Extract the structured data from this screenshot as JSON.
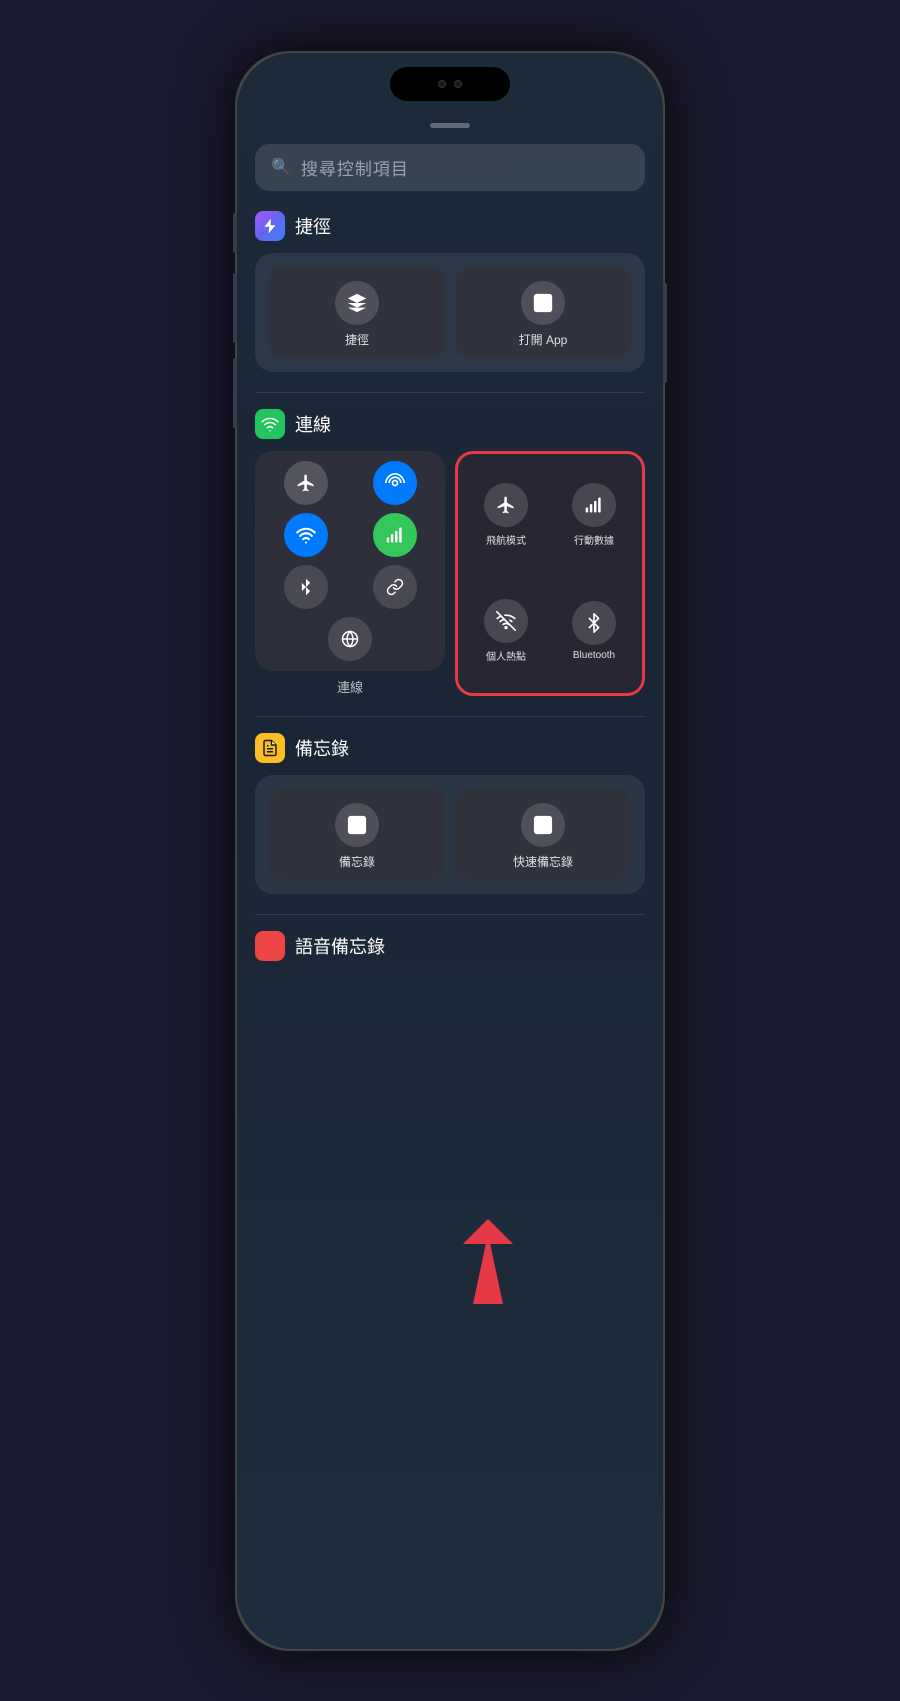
{
  "phone": {
    "search": {
      "placeholder": "搜尋控制項目",
      "icon": "🔍"
    },
    "sections": {
      "shortcuts": {
        "title": "捷徑",
        "items": [
          {
            "label": "捷徑",
            "icon": "shortcuts"
          },
          {
            "label": "打開 App",
            "icon": "open-app"
          }
        ]
      },
      "connectivity": {
        "title": "連線",
        "left_panel_label": "連線",
        "left_items": [
          {
            "icon": "airplane",
            "style": "gray"
          },
          {
            "icon": "hotspot",
            "style": "blue"
          },
          {
            "icon": "wifi",
            "style": "blue"
          },
          {
            "icon": "cellular",
            "style": "green"
          },
          {
            "icon": "bluetooth",
            "style": "dark"
          },
          {
            "icon": "link",
            "style": "dark"
          },
          {
            "icon": "globe",
            "style": "dark"
          }
        ],
        "right_items": [
          {
            "label": "飛航模式",
            "icon": "airplane"
          },
          {
            "label": "行動數據",
            "icon": "cellular"
          },
          {
            "label": "個人熱點",
            "icon": "hotspot-off"
          },
          {
            "label": "Bluetooth",
            "icon": "bluetooth"
          }
        ]
      },
      "notes": {
        "title": "備忘錄",
        "items": [
          {
            "label": "備忘錄",
            "icon": "notes"
          },
          {
            "label": "快速備忘錄",
            "icon": "quick-note"
          }
        ]
      },
      "voice_memos": {
        "title": "語音備忘錄",
        "icon": "waveform"
      }
    }
  }
}
